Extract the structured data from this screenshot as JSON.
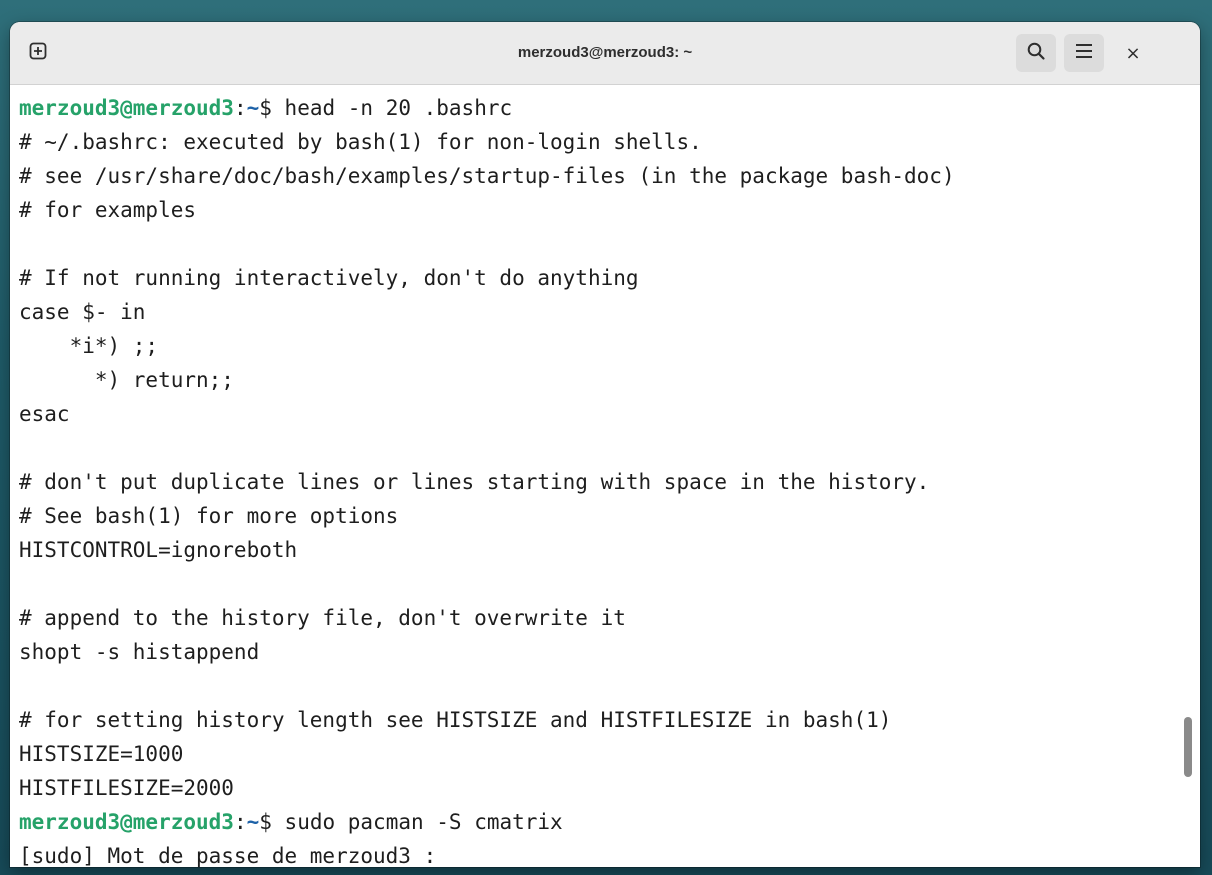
{
  "window": {
    "title": "merzoud3@merzoud3: ~"
  },
  "toolbar": {
    "new_tab_icon": "plus-in-square-icon",
    "search_icon": "search-icon",
    "menu_icon": "hamburger-menu-icon",
    "close_label": "×"
  },
  "colors": {
    "prompt_user": "#26a269",
    "prompt_path": "#1e62a8",
    "text": "#1e1e1e"
  },
  "terminal": {
    "lines": [
      {
        "type": "prompt",
        "user": "merzoud3@merzoud3",
        "sep": ":",
        "path": "~",
        "symbol": "$ ",
        "command": "head -n 20 .bashrc"
      },
      {
        "type": "text",
        "text": "# ~/.bashrc: executed by bash(1) for non-login shells."
      },
      {
        "type": "text",
        "text": "# see /usr/share/doc/bash/examples/startup-files (in the package bash-doc)"
      },
      {
        "type": "text",
        "text": "# for examples"
      },
      {
        "type": "text",
        "text": ""
      },
      {
        "type": "text",
        "text": "# If not running interactively, don't do anything"
      },
      {
        "type": "text",
        "text": "case $- in"
      },
      {
        "type": "text",
        "text": "    *i*) ;;"
      },
      {
        "type": "text",
        "text": "      *) return;;"
      },
      {
        "type": "text",
        "text": "esac"
      },
      {
        "type": "text",
        "text": ""
      },
      {
        "type": "text",
        "text": "# don't put duplicate lines or lines starting with space in the history."
      },
      {
        "type": "text",
        "text": "# See bash(1) for more options"
      },
      {
        "type": "text",
        "text": "HISTCONTROL=ignoreboth"
      },
      {
        "type": "text",
        "text": ""
      },
      {
        "type": "text",
        "text": "# append to the history file, don't overwrite it"
      },
      {
        "type": "text",
        "text": "shopt -s histappend"
      },
      {
        "type": "text",
        "text": ""
      },
      {
        "type": "text",
        "text": "# for setting history length see HISTSIZE and HISTFILESIZE in bash(1)"
      },
      {
        "type": "text",
        "text": "HISTSIZE=1000"
      },
      {
        "type": "text",
        "text": "HISTFILESIZE=2000"
      },
      {
        "type": "prompt",
        "user": "merzoud3@merzoud3",
        "sep": ":",
        "path": "~",
        "symbol": "$ ",
        "command": "sudo pacman -S cmatrix"
      },
      {
        "type": "text",
        "text": "[sudo] Mot de passe de merzoud3 : "
      }
    ]
  }
}
